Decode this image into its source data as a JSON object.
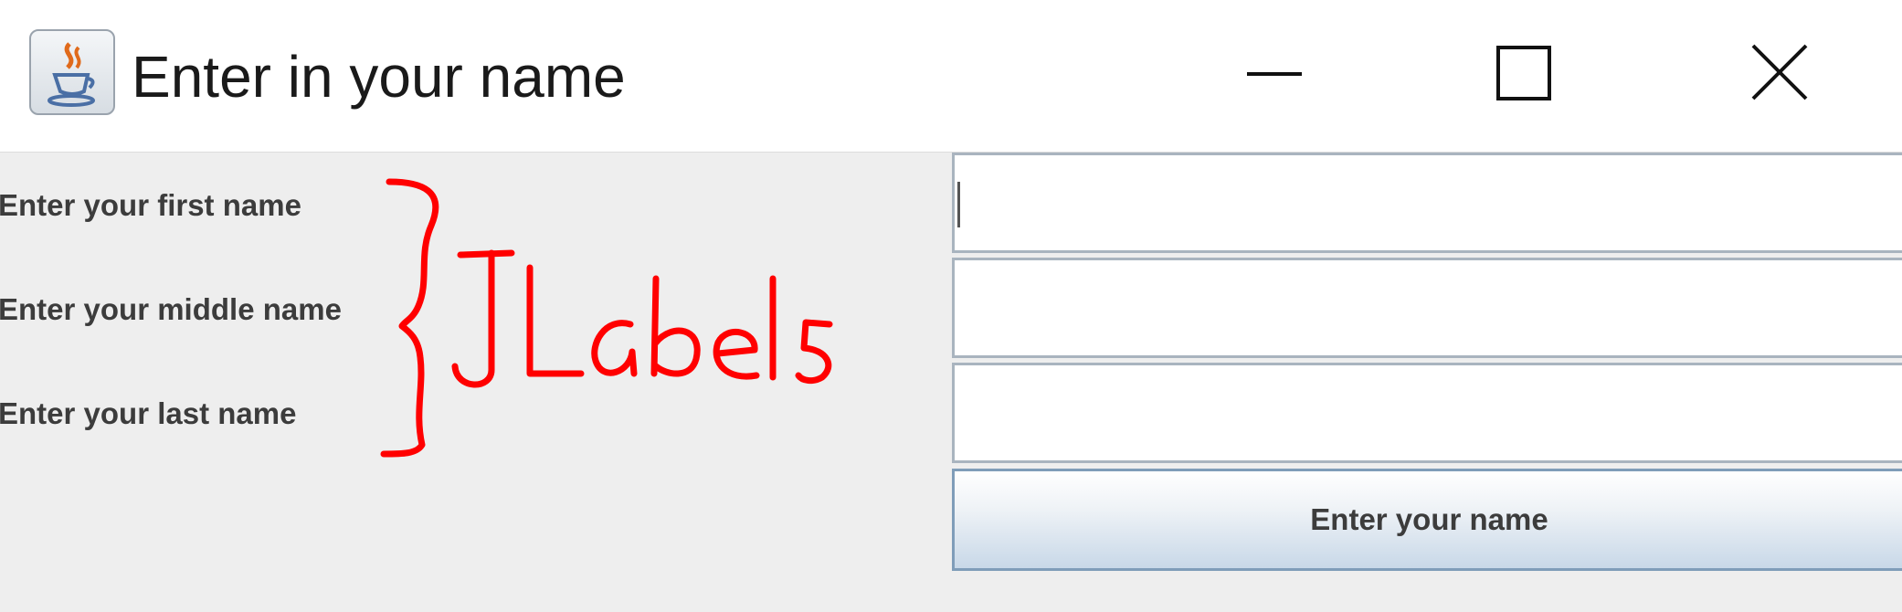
{
  "window": {
    "title": "Enter in your name",
    "icon": "java-cup-icon",
    "controls": [
      "minimize-icon",
      "maximize-icon",
      "close-icon"
    ]
  },
  "form": {
    "labels": {
      "first": "Enter your first name",
      "middle": "Enter your middle name",
      "last": "Enter your last name"
    },
    "fields": {
      "first": "",
      "middle": "",
      "last": ""
    },
    "submit_label": "Enter your name"
  },
  "annotation": {
    "text": "JLabels",
    "color": "#ff0000"
  },
  "colors": {
    "content_bg": "#eeeeee",
    "field_border": "#a9b4bf",
    "button_border": "#7f9db9"
  }
}
